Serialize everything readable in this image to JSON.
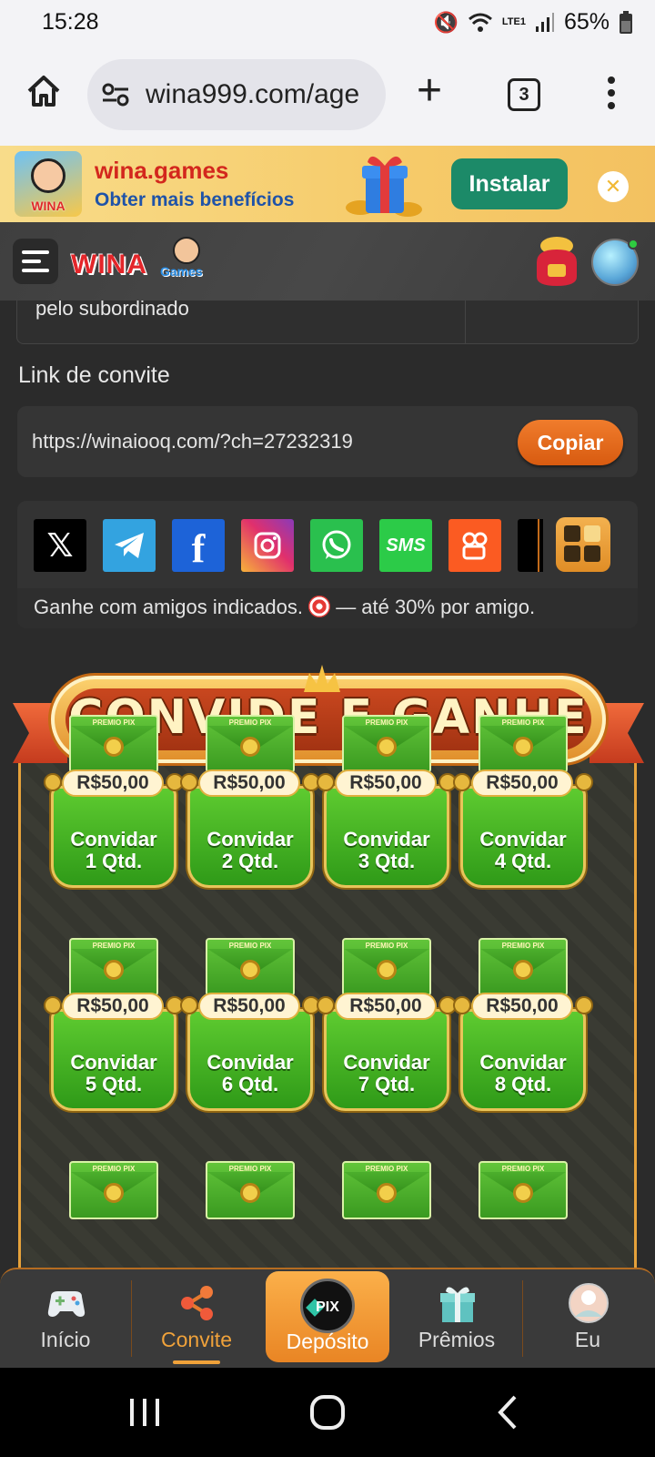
{
  "status": {
    "time": "15:28",
    "network": "LTE1",
    "battery": "65%"
  },
  "browser": {
    "url": "wina999.com/age",
    "tab_count": "3"
  },
  "banner": {
    "title": "wina.games",
    "subtitle": "Obter mais benefícios",
    "install_label": "Instalar",
    "logo_text": "WINA"
  },
  "header": {
    "logo_text": "WINA",
    "logo_sub": "Games"
  },
  "invite": {
    "partial_row_text": "pelo subordinado",
    "link_label": "Link de convite",
    "link_url": "https://winaiooq.com/?ch=27232319",
    "copy_label": "Copiar",
    "share_footer": "Ganhe com amigos indicados.",
    "share_footer_suffix": "— até 30% por amigo.",
    "share_icons": [
      "x-icon",
      "telegram-icon",
      "facebook-icon",
      "instagram-icon",
      "whatsapp-icon",
      "sms-icon",
      "kwai-icon",
      "tiktok-icon"
    ],
    "sms_text": "SMS"
  },
  "promo": {
    "title": "CONVIDE E GANHE",
    "envelope_label": "PREMIO PIX",
    "cards": [
      {
        "amount": "R$50,00",
        "label1": "Convidar",
        "label2": "1 Qtd."
      },
      {
        "amount": "R$50,00",
        "label1": "Convidar",
        "label2": "2 Qtd."
      },
      {
        "amount": "R$50,00",
        "label1": "Convidar",
        "label2": "3 Qtd."
      },
      {
        "amount": "R$50,00",
        "label1": "Convidar",
        "label2": "4 Qtd."
      },
      {
        "amount": "R$50,00",
        "label1": "Convidar",
        "label2": "5 Qtd."
      },
      {
        "amount": "R$50,00",
        "label1": "Convidar",
        "label2": "6 Qtd."
      },
      {
        "amount": "R$50,00",
        "label1": "Convidar",
        "label2": "7 Qtd."
      },
      {
        "amount": "R$50,00",
        "label1": "Convidar",
        "label2": "8 Qtd."
      }
    ]
  },
  "nav": {
    "items": [
      {
        "label": "Início"
      },
      {
        "label": "Convite"
      },
      {
        "label": "Depósito"
      },
      {
        "label": "Prêmios"
      },
      {
        "label": "Eu"
      }
    ],
    "pix_text": "PIX",
    "active": "Convite"
  },
  "colors": {
    "accent": "#f0a23a",
    "primary_green": "#2f9a18",
    "copy_button": "#e06a1c"
  }
}
